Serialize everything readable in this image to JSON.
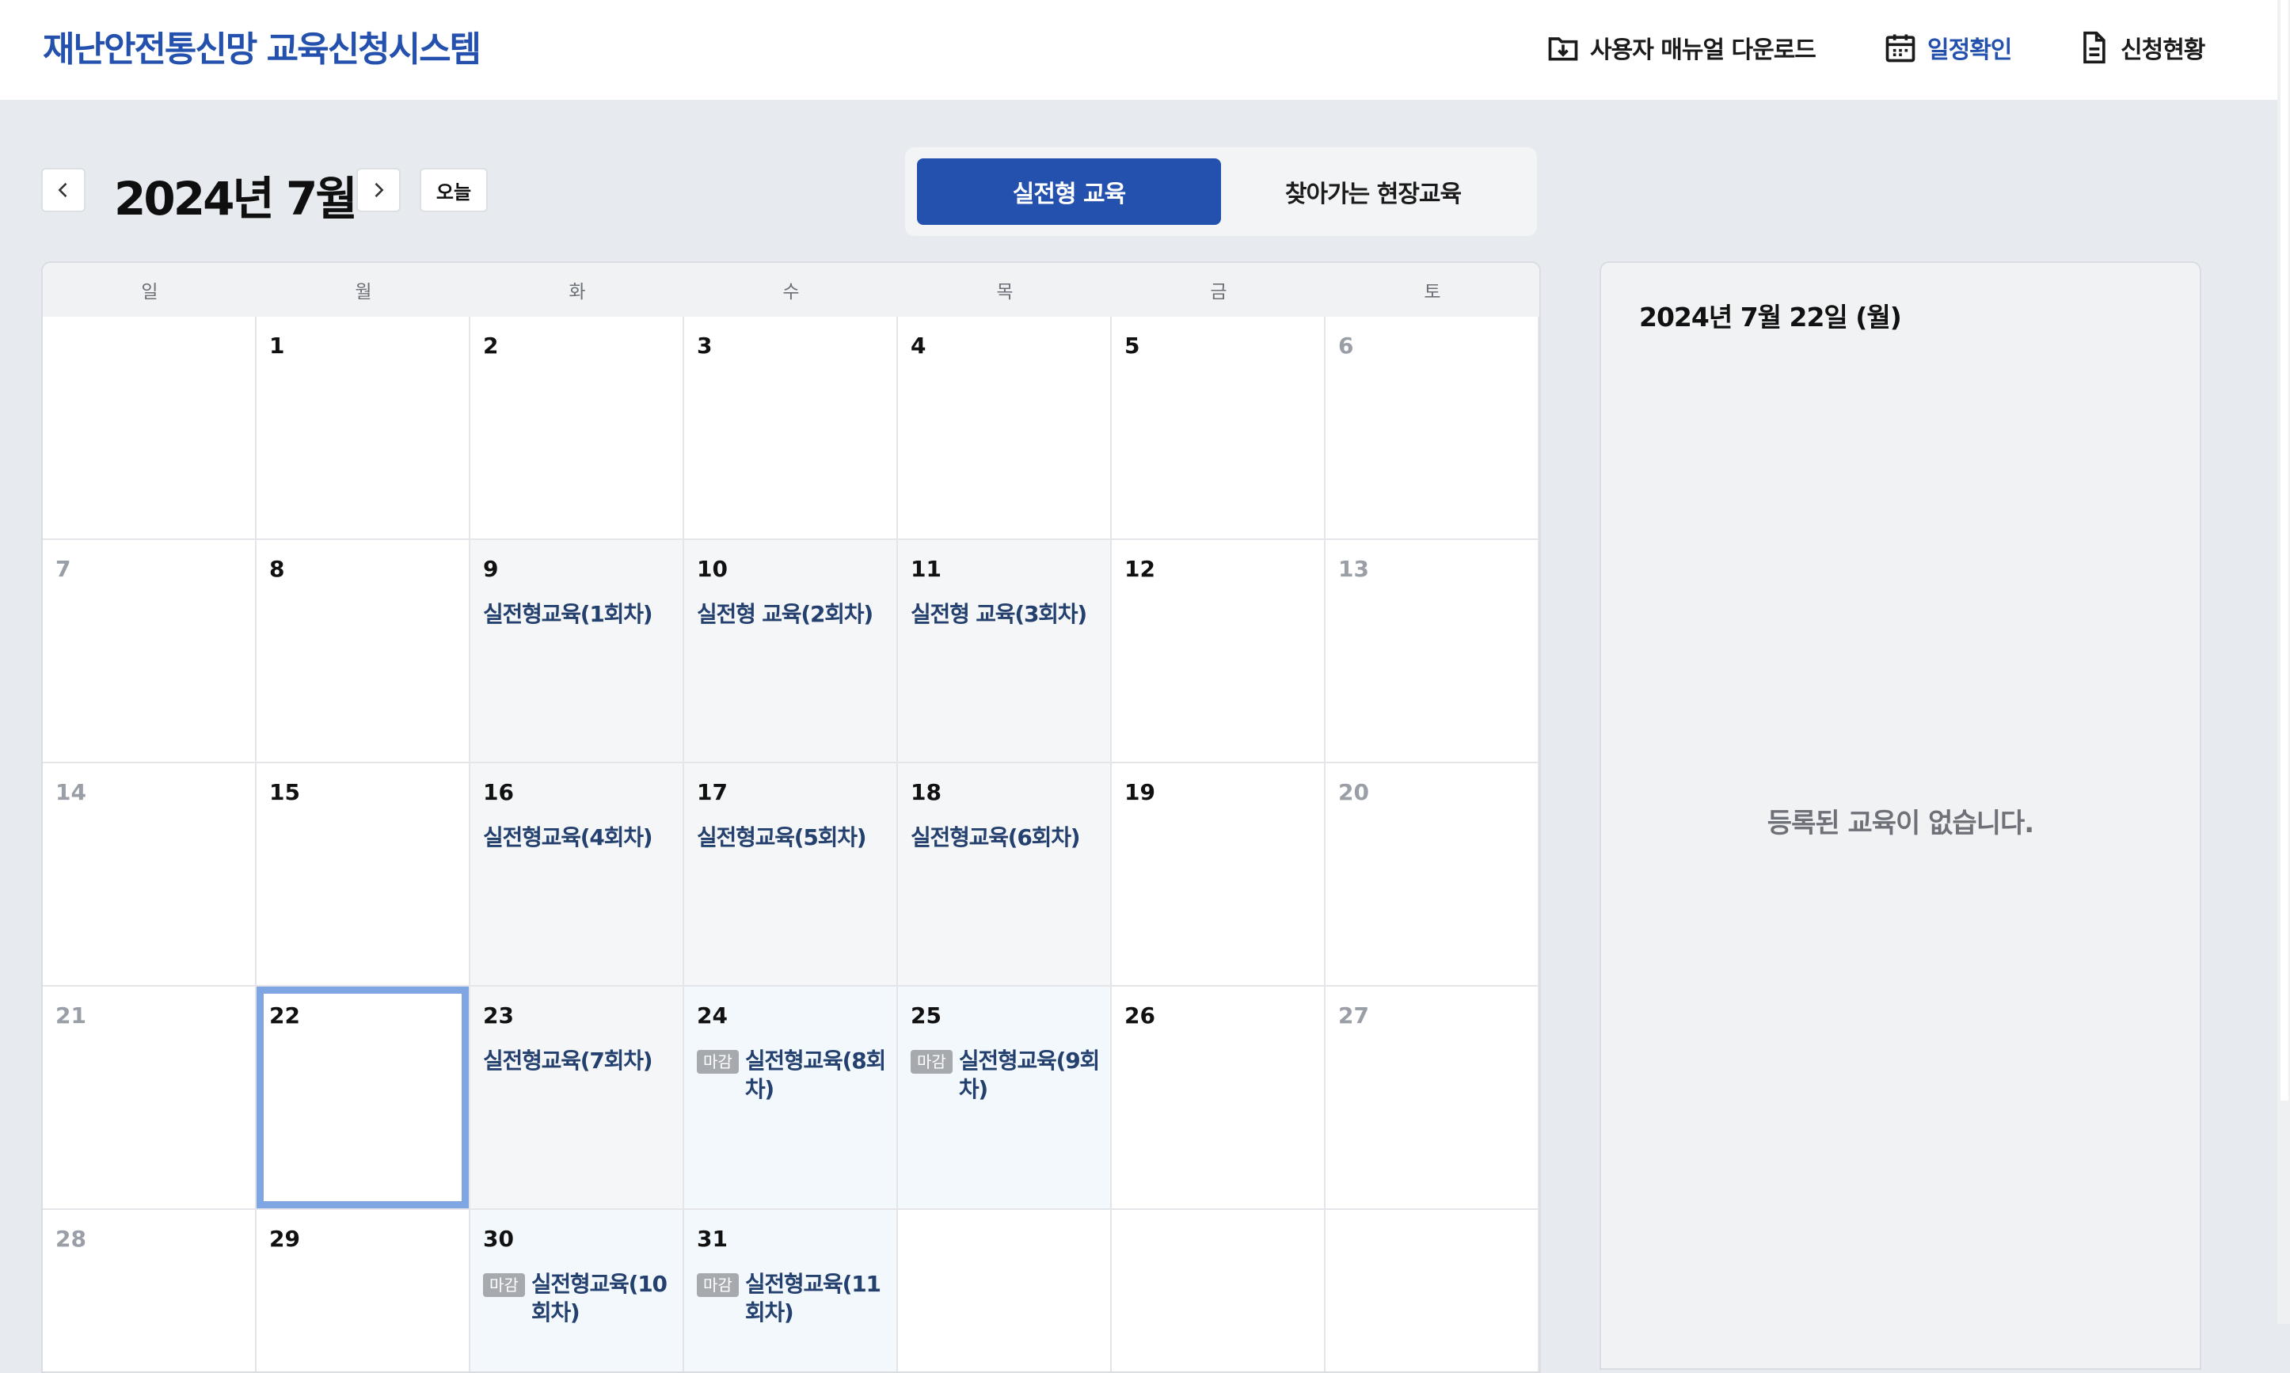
{
  "header": {
    "brand": "재난안전통신망 교육신청시스템",
    "nav": [
      {
        "label": "사용자 매뉴얼 다운로드",
        "icon": "download-folder-icon",
        "active": false
      },
      {
        "label": "일정확인",
        "icon": "calendar-icon",
        "active": true
      },
      {
        "label": "신청현황",
        "icon": "document-icon",
        "active": false
      }
    ]
  },
  "toolbar": {
    "prev_icon": "chevron-left-icon",
    "month_title": "2024년 7월",
    "next_icon": "chevron-right-icon",
    "today_label": "오늘"
  },
  "tabs": [
    {
      "label": "실전형 교육",
      "active": true
    },
    {
      "label": "찾아가는 현장교육",
      "active": false
    }
  ],
  "calendar": {
    "weekdays": [
      "일",
      "월",
      "화",
      "수",
      "목",
      "금",
      "토"
    ],
    "selected_day": "22",
    "days": [
      {
        "day": "",
        "event": "",
        "closed": false
      },
      {
        "day": "1",
        "event": "",
        "closed": false
      },
      {
        "day": "2",
        "event": "",
        "closed": false
      },
      {
        "day": "3",
        "event": "",
        "closed": false
      },
      {
        "day": "4",
        "event": "",
        "closed": false
      },
      {
        "day": "5",
        "event": "",
        "closed": false
      },
      {
        "day": "6",
        "event": "",
        "closed": false
      },
      {
        "day": "7",
        "event": "",
        "closed": false
      },
      {
        "day": "8",
        "event": "",
        "closed": false
      },
      {
        "day": "9",
        "event": "실전형교육(1회차)",
        "closed": false
      },
      {
        "day": "10",
        "event": "실전형 교육(2회차)",
        "closed": false
      },
      {
        "day": "11",
        "event": "실전형 교육(3회차)",
        "closed": false
      },
      {
        "day": "12",
        "event": "",
        "closed": false
      },
      {
        "day": "13",
        "event": "",
        "closed": false
      },
      {
        "day": "14",
        "event": "",
        "closed": false
      },
      {
        "day": "15",
        "event": "",
        "closed": false
      },
      {
        "day": "16",
        "event": "실전형교육(4회차)",
        "closed": false
      },
      {
        "day": "17",
        "event": "실전형교육(5회차)",
        "closed": false
      },
      {
        "day": "18",
        "event": "실전형교육(6회차)",
        "closed": false
      },
      {
        "day": "19",
        "event": "",
        "closed": false
      },
      {
        "day": "20",
        "event": "",
        "closed": false
      },
      {
        "day": "21",
        "event": "",
        "closed": false
      },
      {
        "day": "22",
        "event": "",
        "closed": false
      },
      {
        "day": "23",
        "event": "실전형교육(7회차)",
        "closed": false
      },
      {
        "day": "24",
        "event": "실전형교육(8회차)",
        "closed": true
      },
      {
        "day": "25",
        "event": "실전형교육(9회차)",
        "closed": true
      },
      {
        "day": "26",
        "event": "",
        "closed": false
      },
      {
        "day": "27",
        "event": "",
        "closed": false
      },
      {
        "day": "28",
        "event": "",
        "closed": false
      },
      {
        "day": "29",
        "event": "",
        "closed": false
      },
      {
        "day": "30",
        "event": "실전형교육(10회차)",
        "closed": true
      },
      {
        "day": "31",
        "event": "실전형교육(11회차)",
        "closed": true
      },
      {
        "day": "",
        "event": "",
        "closed": false
      },
      {
        "day": "",
        "event": "",
        "closed": false
      },
      {
        "day": "",
        "event": "",
        "closed": false
      }
    ],
    "closed_badge": "마감"
  },
  "side_panel": {
    "date": "2024년 7월 22일 (월)",
    "empty_message": "등록된 교육이 없습니다."
  },
  "colors": {
    "brand": "#2451ad",
    "event_text": "#24406e",
    "selected_border": "#7fa6e3",
    "closed_badge": "#a6a9ae"
  }
}
